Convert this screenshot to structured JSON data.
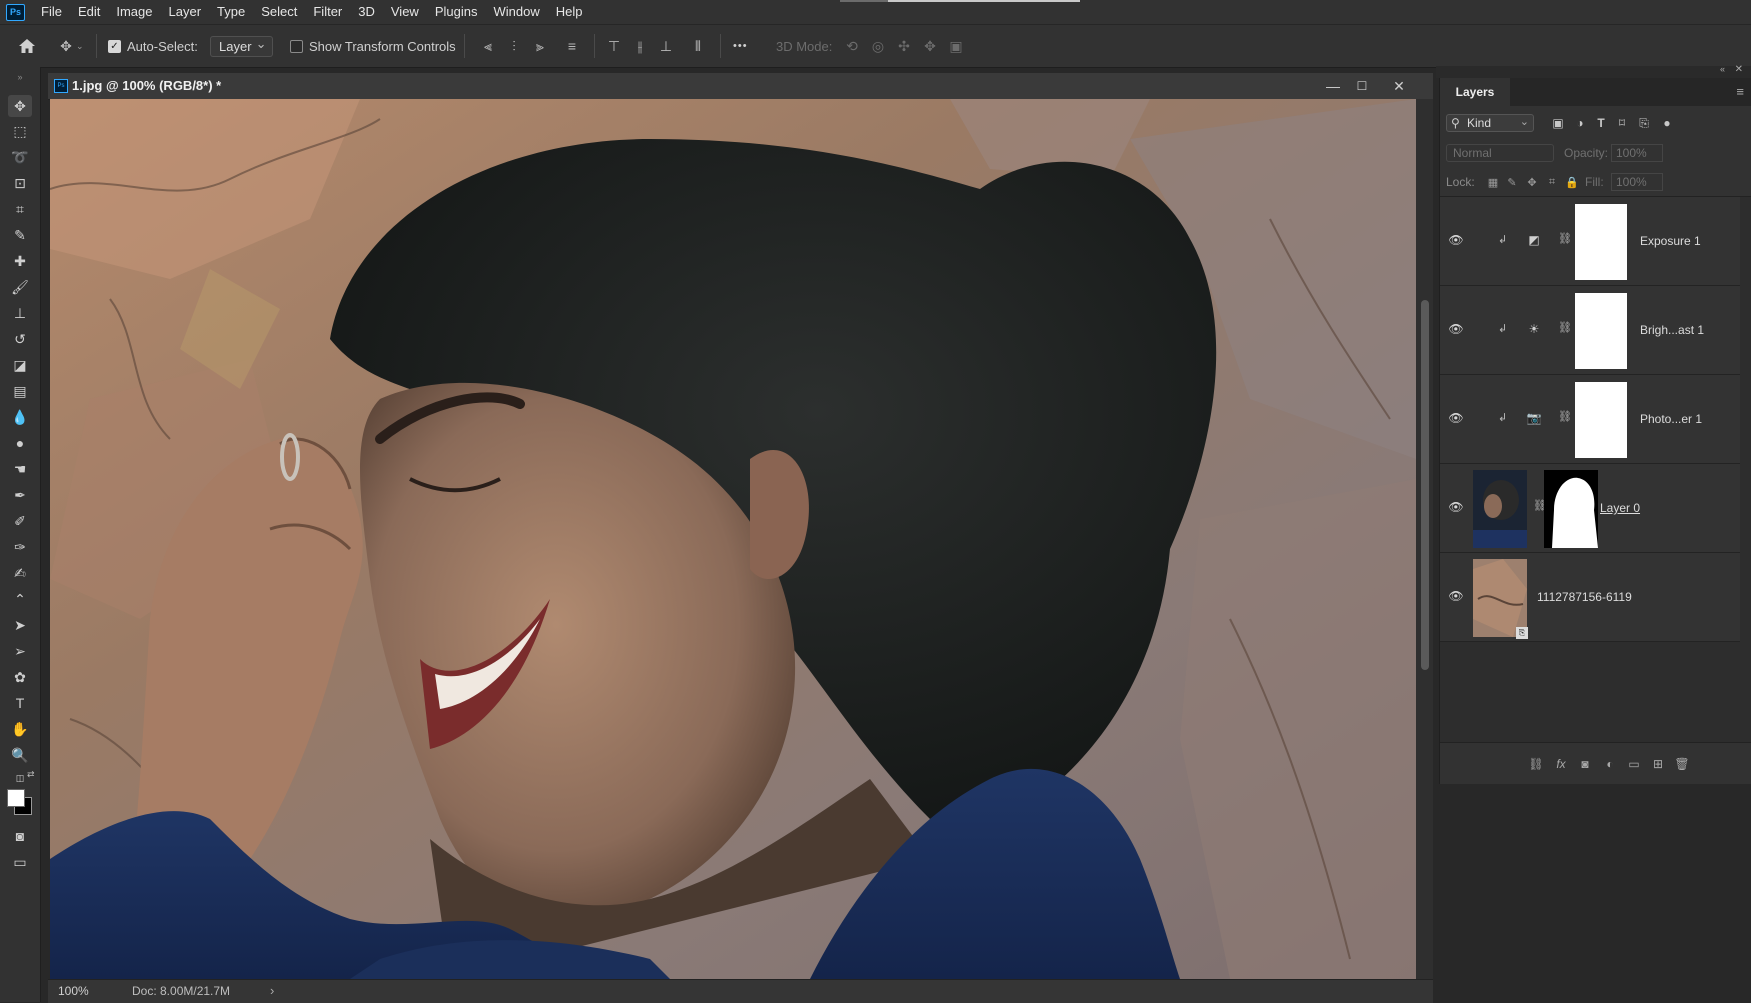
{
  "app": {
    "logo_text": "Ps"
  },
  "menu": {
    "items": [
      "File",
      "Edit",
      "Image",
      "Layer",
      "Type",
      "Select",
      "Filter",
      "3D",
      "View",
      "Plugins",
      "Window",
      "Help"
    ]
  },
  "options": {
    "auto_select_label": "Auto-Select:",
    "auto_select_checked": true,
    "auto_select_target": "Layer",
    "show_transform_label": "Show Transform Controls",
    "show_transform_checked": false,
    "mode_label": "3D Mode:",
    "more_glyph": "•••"
  },
  "document": {
    "title": "1.jpg @ 100% (RGB/8*) *",
    "zoom": "100%",
    "doc_info": "Doc: 8.00M/21.7M",
    "minimize_glyph": "—",
    "maximize_glyph": "☐",
    "close_glyph": "✕"
  },
  "layers_panel": {
    "tab": "Layers",
    "filter_kind": "Kind",
    "blend_mode": "Normal",
    "opacity_label": "Opacity:",
    "opacity_value": "100%",
    "lock_label": "Lock:",
    "fill_label": "Fill:",
    "fill_value": "100%",
    "layers": [
      {
        "name": "Exposure 1",
        "type": "adjustment",
        "icon": "exposure-icon",
        "visible": true
      },
      {
        "name": "Brigh...ast 1",
        "type": "adjustment",
        "icon": "brightness-contrast-icon",
        "visible": true
      },
      {
        "name": "Photo...er 1",
        "type": "adjustment",
        "icon": "photo-filter-icon",
        "visible": true
      },
      {
        "name": "Layer 0",
        "type": "pixel-with-mask",
        "visible": true,
        "selected": true
      },
      {
        "name": "1112787156-6119",
        "type": "smart-object",
        "visible": true
      }
    ]
  },
  "colors": {
    "accent": "#31a8ff",
    "panel_bg": "#323232",
    "workspace_bg": "#282828"
  }
}
